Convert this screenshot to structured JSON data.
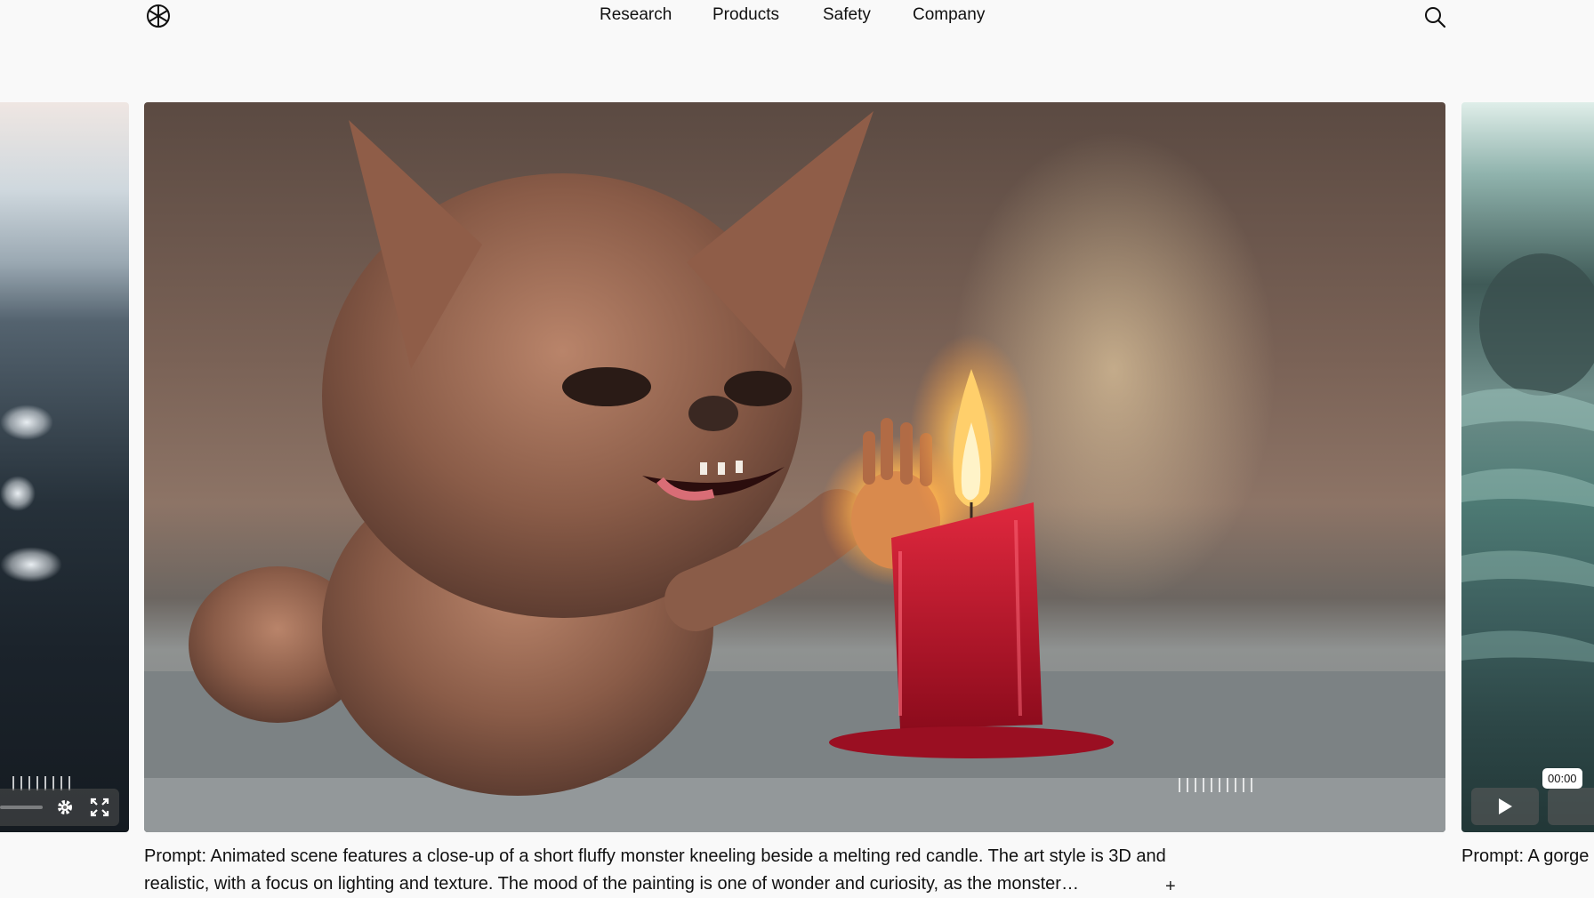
{
  "nav": {
    "items": [
      {
        "label": "Research"
      },
      {
        "label": "Products"
      },
      {
        "label": "Safety"
      },
      {
        "label": "Company"
      }
    ]
  },
  "icons": {
    "logo": "openai-logo-icon",
    "search": "search-icon",
    "settings": "gear-icon",
    "fullscreen": "fullscreen-icon",
    "play": "play-icon",
    "expand": "plus-icon"
  },
  "player": {
    "time": "00:00"
  },
  "captions": {
    "main": "Prompt: Animated scene features a close-up of a short fluffy monster kneeling beside a melting red candle. The art style is 3D and realistic, with a focus on lighting and texture. The mood of the painting is one of wonder and curiosity, as the monster…",
    "next": "Prompt: A gorge",
    "expand_label": "+"
  },
  "colors": {
    "background": "#f9f9f9",
    "candle": "#c8102e",
    "flame": "#ffcf6b"
  }
}
